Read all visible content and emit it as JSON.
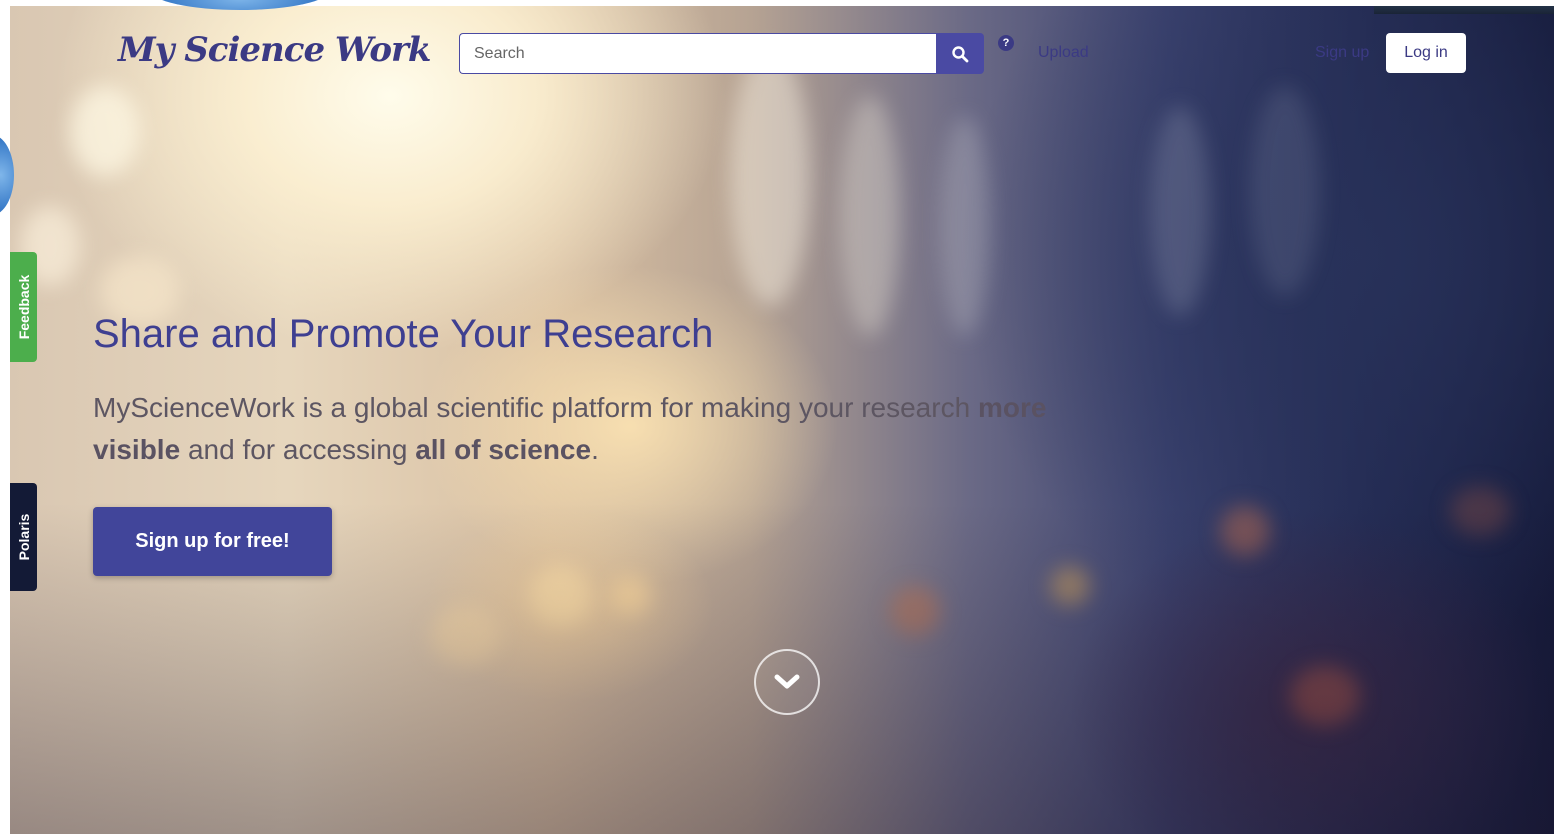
{
  "header": {
    "logo_text": "My Science Work",
    "search_placeholder": "Search",
    "help_symbol": "?",
    "upload_label": "Upload",
    "signup_label": "Sign up",
    "login_label": "Log in"
  },
  "side_tabs": {
    "feedback_label": "Feedback",
    "polaris_label": "Polaris"
  },
  "hero": {
    "title": "Share and Promote Your Research",
    "desc_part1": "MyScienceWork is a global scientific platform for making your research ",
    "desc_bold1": "more visible",
    "desc_part2": " and for accessing ",
    "desc_bold2": "all of science",
    "desc_part3": ".",
    "cta_label": "Sign up for free!"
  },
  "icons": {
    "search": "search-icon",
    "help": "question-circle-icon",
    "scroll": "chevron-down-icon"
  },
  "colors": {
    "brand": "#3b3a84",
    "button": "#41459a",
    "feedback": "#4cae4c",
    "polaris": "#131a36"
  }
}
